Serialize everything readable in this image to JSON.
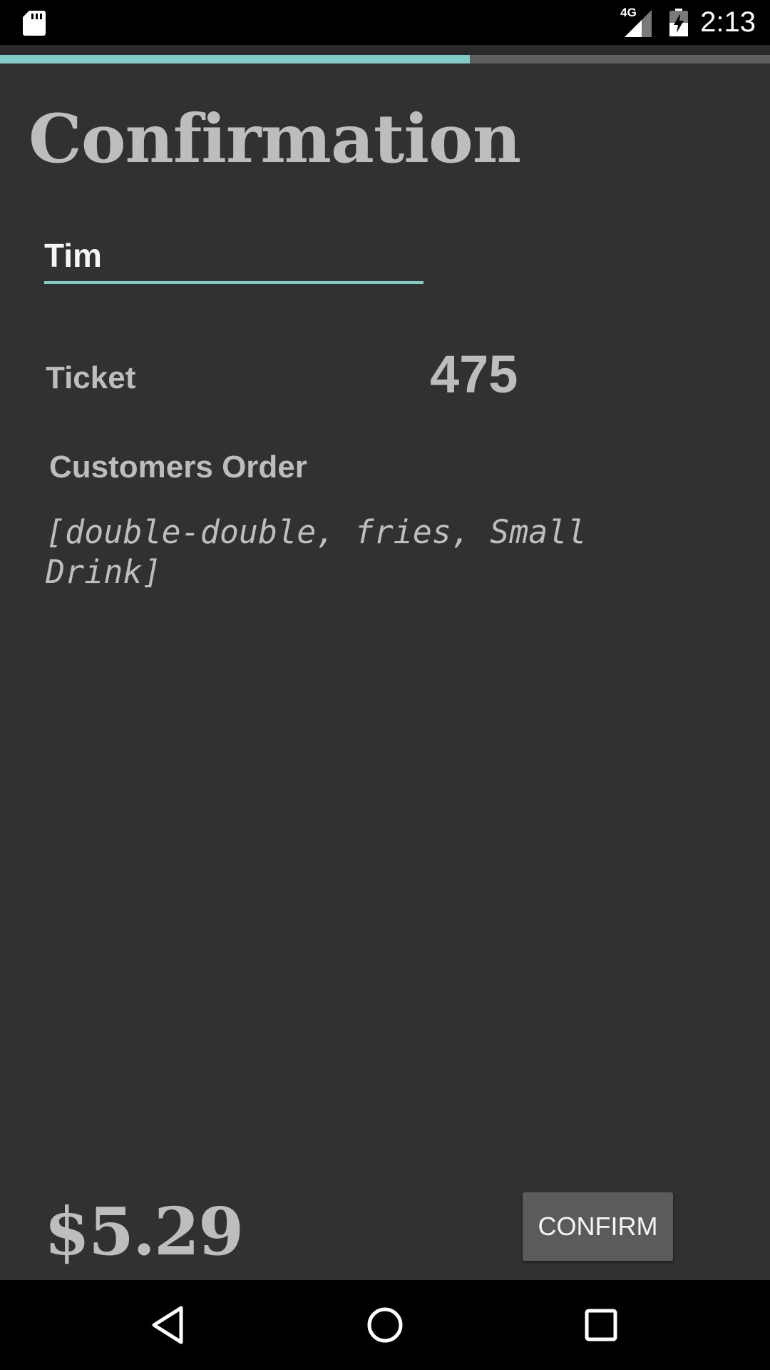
{
  "status_bar": {
    "network": "4G",
    "time": "2:13",
    "icons": [
      "sd-card-icon",
      "signal-icon",
      "battery-charging-icon"
    ]
  },
  "progress": {
    "fraction": 0.61,
    "color": "#80cbc4"
  },
  "page": {
    "title": "Confirmation"
  },
  "customer": {
    "name_value": "Tim"
  },
  "ticket": {
    "label": "Ticket",
    "number": "475"
  },
  "order": {
    "label": "Customers Order",
    "items_text": "[double-double, fries, Small Drink]"
  },
  "footer": {
    "price": "$5.29",
    "confirm_label": "CONFIRM"
  },
  "nav": {
    "icons": [
      "back-icon",
      "home-icon",
      "recents-icon"
    ]
  },
  "colors": {
    "background": "#313131",
    "accent": "#80cbc4",
    "text": "#bdbdbd",
    "button": "#5b5b5b"
  }
}
